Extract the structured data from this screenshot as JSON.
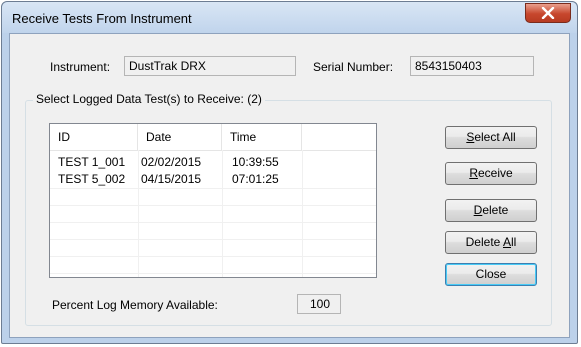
{
  "window": {
    "title": "Receive Tests From Instrument",
    "close_glyph": "✕"
  },
  "instrument": {
    "label": "Instrument:",
    "value": "DustTrak DRX"
  },
  "serial": {
    "label": "Serial Number:",
    "value": "8543150403"
  },
  "group": {
    "label": "Select Logged Data Test(s) to Receive: (2)"
  },
  "list": {
    "columns": [
      "ID",
      "Date",
      "Time"
    ],
    "rows": [
      [
        "TEST 1_001",
        "02/02/2015",
        "10:39:55"
      ],
      [
        "TEST 5_002",
        "04/15/2015",
        "07:01:25"
      ]
    ]
  },
  "buttons": {
    "select_all": {
      "mnemonic": "S",
      "rest": "elect All"
    },
    "receive": {
      "mnemonic": "R",
      "rest": "eceive"
    },
    "delete": {
      "mnemonic": "D",
      "rest": "elete"
    },
    "delete_all": {
      "pre": "Delete ",
      "mnemonic": "A",
      "rest": "ll"
    },
    "close": {
      "label": "Close"
    }
  },
  "memory": {
    "label": "Percent Log Memory Available:",
    "value": "100"
  }
}
